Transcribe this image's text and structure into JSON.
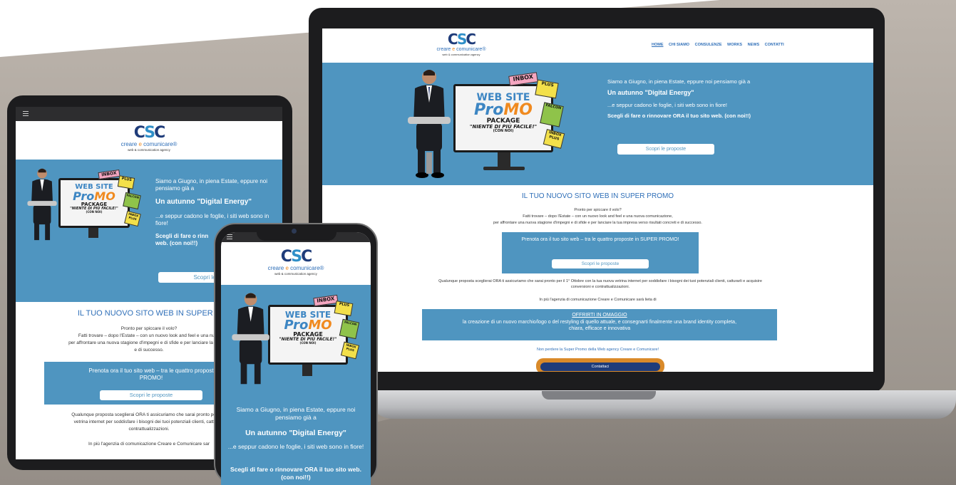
{
  "site": {
    "logo": {
      "mark_left": "C",
      "mark_mid": "S",
      "mark_right": "C",
      "name_a": "creare",
      "name_sep": "e",
      "name_b": "comunicare",
      "reg": "®",
      "subtitle": "web & communication agency"
    },
    "nav": [
      {
        "label": "HOME"
      },
      {
        "label": "CHI SIAMO"
      },
      {
        "label": "CONSULENZE"
      },
      {
        "label": "WORKS"
      },
      {
        "label": "NEWS"
      },
      {
        "label": "CONTATTI"
      }
    ],
    "hero": {
      "line1": "Siamo a Giugno, in piena Estate, eppure noi pensiamo già a",
      "headline": "Un autunno \"Digital Energy\"",
      "line2": "...e seppur cadono le foglie, i siti web sono in fiore!",
      "line3": "Scegli di fare o rinnovare ORA il tuo sito web. (con noi!!)",
      "button": "Scopri le proposte"
    },
    "promo_art": {
      "w1": "WEB SITE",
      "w2a": "Pro",
      "w2b": "MO",
      "w3": "PACKAGE",
      "w4": "\"NIENTE DI PIÙ FACILE!\"",
      "w5": "(CON NOI)",
      "sticker1": "INBOX",
      "sticker2": "PLUS",
      "sticker3": "FALCON",
      "sticker4": "INBOX PLUS"
    },
    "section": {
      "title": "IL TUO NUOVO SITO WEB IN SUPER PROMO",
      "p1": "Pronto per spiccare il volo?",
      "p2": "Fatti trovare – dopo l'Estate – con un nuovo look and feel e una nuova comunicazione,",
      "p3": "per affrontare una nuova stagione d'impegni e di sfide e per lanciare la tua impresa verso risultati concreti e di successo.",
      "box_text": "Prenota ora il tuo sito web – tra le quattro proposte in SUPER PROMO!",
      "box_button": "Scopri le proposte",
      "p4": "Qualunque proposta sceglierai ORA ti assicuriamo che sarai pronto per il 1° Ottobre con la tua nuova vetrina internet per soddisfare i bisogni dei tuoi potenziali clienti, catturarli e acquisire conversioni e contrattualizzazioni.",
      "p5": "In più l'agenzia di comunicazione Creare e Comunicare sarà lieta di",
      "offer_title": "OFFRIRTI IN OMAGGIO",
      "offer_text": "la creazione di un nuovo marchio/logo o del restyling di quello attuale, e consegnarti finalmente una brand identity completa, chiara, efficace e innovativa",
      "p6": "Non perdere la Super Promo della Web agency Creare e Comunicare!",
      "contact_button": "Contattaci"
    },
    "tablet": {
      "menu_icon": "hamburger-icon",
      "p2_cut": "Fatti trovare – dopo l'Estate – con un nuovo look and feel e una nuov",
      "p3_cut": "per affrontare una nuova stagione d'impegni e di sfide e per lanciare la tua imp",
      "p3_end": "e di successo.",
      "title_cut": "IL TUO NUOVO SITO WEB IN SUPER P",
      "box_text_a": "Prenota ora il tuo sito web – tra le quattro propost",
      "box_text_b": "PROMO!",
      "p4_a": "Qualunque proposta sceglierai ORA ti assicuriamo che sarai pronto per il 1°",
      "p4_b": "vetrina internet per soddisfare i bisogni dei tuoi potenziali clienti, catturarli",
      "p4_c": "contrattualizzazioni.",
      "p5_cut": "In più l'agenzia di comunicazione Creare e Comunicare sar",
      "hero_line1": "Siamo a Giugno, in piena Estate, eppure noi pensiamo già a",
      "hero_line2": "...e seppur cadono le foglie, i siti web sono in fiore!",
      "hero_line3_cut": "Scegli di fare o rinn",
      "hero_line3_end": "web. (con noi!!)",
      "hero_button_cut": "Scopri le"
    },
    "phone": {
      "menu_icon": "hamburger-icon"
    }
  },
  "colors": {
    "hero_blue": "#4f95c0",
    "brand_blue": "#2f6fb8",
    "brand_orange": "#f08a1f",
    "dark_navy": "#1f3c7a"
  }
}
